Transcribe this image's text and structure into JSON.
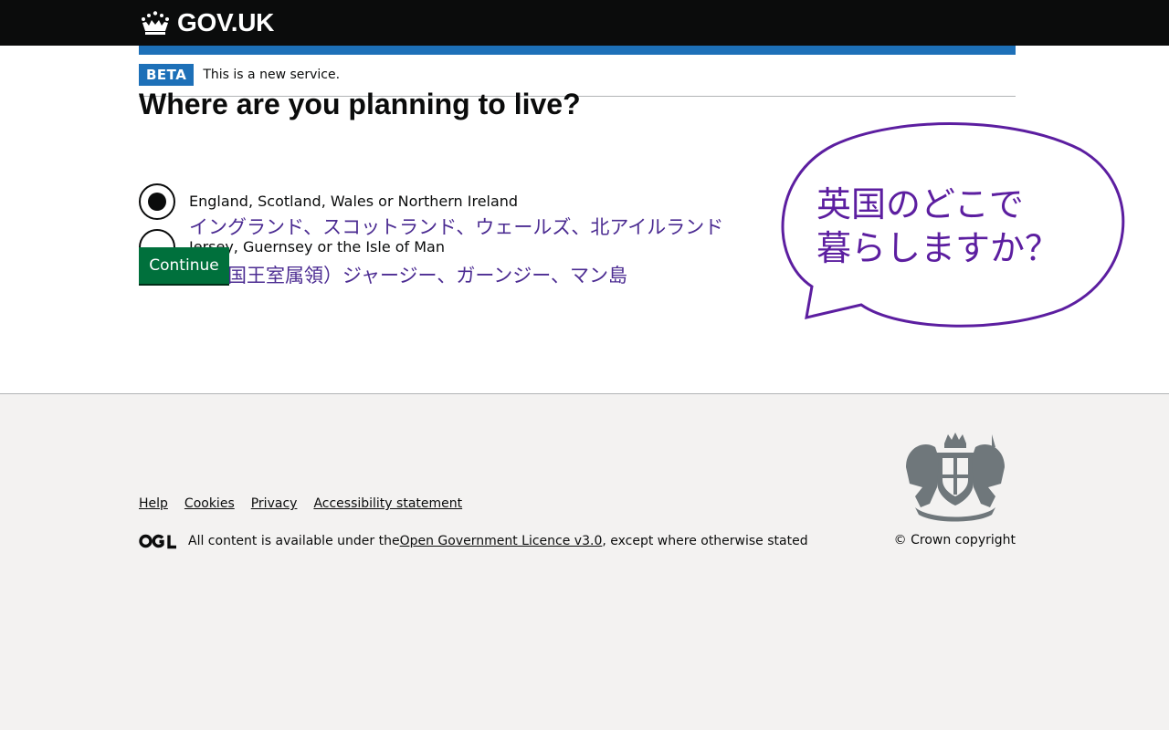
{
  "header": {
    "logo_text": "GOV.UK"
  },
  "phase": {
    "tag": "BETA",
    "text": "This is a new service."
  },
  "form": {
    "question": "Where are you planning to live?",
    "options": [
      {
        "label": "England, Scotland, Wales or Northern Ireland",
        "annotation": "イングランド、スコットランド、ウェールズ、北アイルランド",
        "checked": true
      },
      {
        "label": "Jersey, Guernsey or the Isle of Man",
        "annotation": "（英国王室属領）ジャージー、ガーンジー、マン島",
        "checked": false
      }
    ],
    "continue_label": "Continue"
  },
  "speech_bubble": {
    "line1": "英国のどこで",
    "line2": "暮らしますか？"
  },
  "footer": {
    "links": [
      "Help",
      "Cookies",
      "Privacy",
      "Accessibility statement"
    ],
    "licence_prefix": "All content is available under the ",
    "licence_link": "Open Government Licence v3.0",
    "licence_suffix": ", except where otherwise stated",
    "copyright": "© Crown copyright"
  },
  "colors": {
    "header_bg": "#0b0c0c",
    "brand_blue": "#1d70b8",
    "button_green": "#00703c",
    "annotation_purple": "#4c2c92",
    "footer_bg": "#f3f2f1"
  }
}
